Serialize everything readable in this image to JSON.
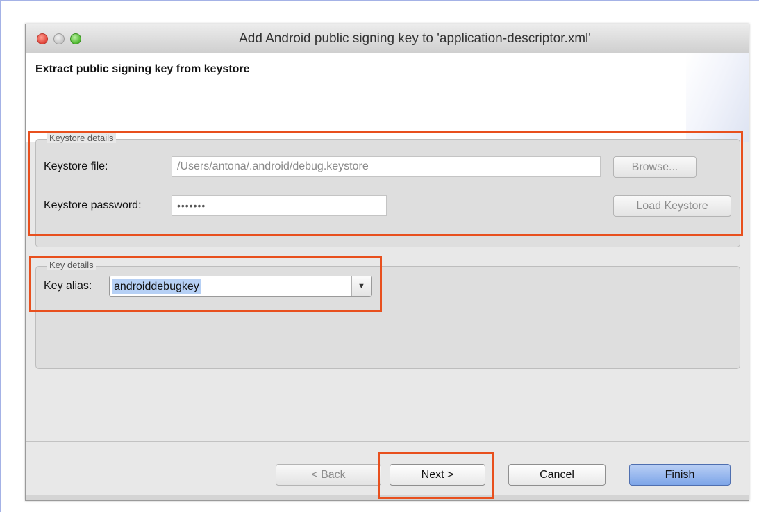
{
  "window": {
    "title": "Add Android public signing key to 'application-descriptor.xml'"
  },
  "banner": {
    "heading": "Extract public signing key from keystore"
  },
  "keystore_group": {
    "legend": "Keystore details",
    "file_label": "Keystore file:",
    "file_value": "/Users/antona/.android/debug.keystore",
    "password_label": "Keystore password:",
    "password_value": "•••••••",
    "browse_label": "Browse...",
    "load_label": "Load Keystore"
  },
  "key_group": {
    "legend": "Key details",
    "alias_label": "Key alias:",
    "alias_value": "androiddebugkey",
    "dropdown_icon": "chevron-down-icon"
  },
  "footer": {
    "back_label": "< Back",
    "next_label": "Next >",
    "cancel_label": "Cancel",
    "finish_label": "Finish"
  },
  "colors": {
    "highlight": "#e8501e",
    "primary_button": "#7da5e8",
    "frame_border": "#a4b2e6"
  }
}
